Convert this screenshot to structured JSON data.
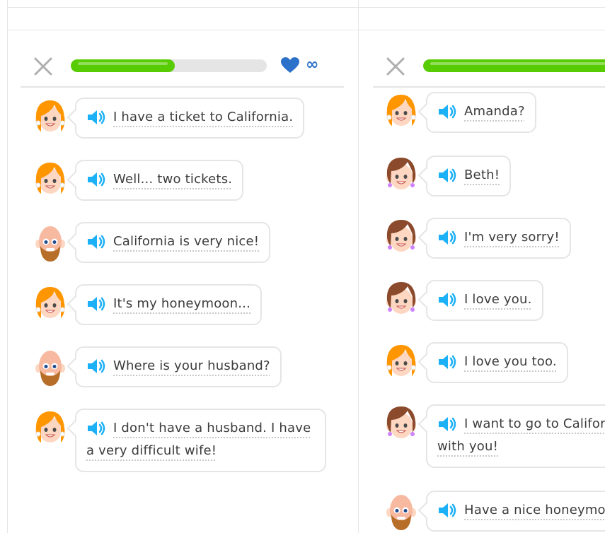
{
  "colors": {
    "progress": "#58cc02",
    "accent": "#1cb0f6",
    "heart": "#2b70c9",
    "border": "#e5e5e5"
  },
  "left_panel": {
    "progress": 0.53,
    "hearts": "∞",
    "messages": [
      {
        "speaker": "girl",
        "text": "I have a ticket to California."
      },
      {
        "speaker": "girl",
        "text": "Well... two tickets."
      },
      {
        "speaker": "bald-man",
        "text": "California is very nice!"
      },
      {
        "speaker": "girl",
        "text": "It's my honeymoon..."
      },
      {
        "speaker": "bald-man",
        "text": "Where is your husband?"
      },
      {
        "speaker": "girl",
        "text": "I don't have a husband. I have a very difficult wife!"
      }
    ]
  },
  "right_panel": {
    "progress": 0.9,
    "messages": [
      {
        "speaker": "girl",
        "text": "Amanda?"
      },
      {
        "speaker": "brunette",
        "text": "Beth!"
      },
      {
        "speaker": "brunette",
        "text": "I'm very sorry!"
      },
      {
        "speaker": "brunette",
        "text": "I love you."
      },
      {
        "speaker": "girl",
        "text": "I love you too."
      },
      {
        "speaker": "brunette",
        "text": "I want to go to California with you!"
      },
      {
        "speaker": "bald-man",
        "text": "Have a nice honeymoon!"
      }
    ]
  }
}
